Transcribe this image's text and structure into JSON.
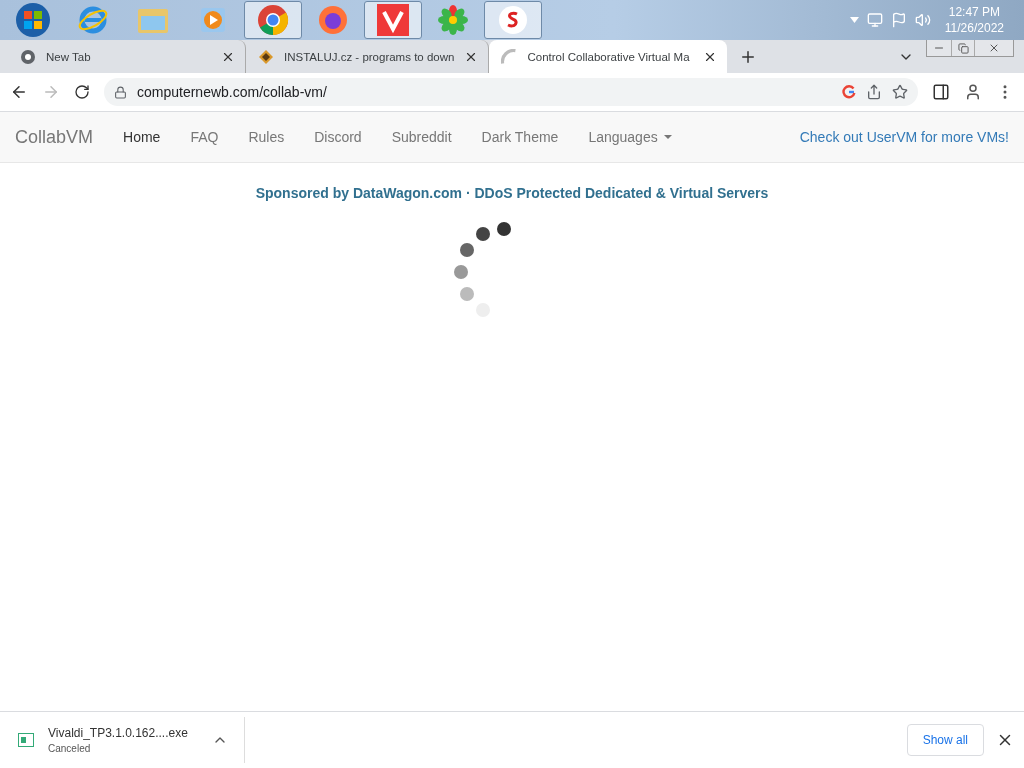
{
  "taskbar": {
    "apps": [
      {
        "kind": "start",
        "running": false
      },
      {
        "kind": "ie",
        "running": false
      },
      {
        "kind": "folder",
        "running": false
      },
      {
        "kind": "media",
        "running": false
      },
      {
        "kind": "chrome",
        "running": true
      },
      {
        "kind": "firefox",
        "running": false
      },
      {
        "kind": "vivaldi",
        "running": true
      },
      {
        "kind": "flower",
        "running": false
      },
      {
        "kind": "s",
        "running": true
      }
    ],
    "time": "12:47 PM",
    "date": "11/26/2022"
  },
  "tabs": [
    {
      "title": "New Tab",
      "kind": "chrome",
      "selected": false
    },
    {
      "title": "INSTALUJ.cz - programs to down",
      "kind": "diamond",
      "selected": false
    },
    {
      "title": "Control Collaborative Virtual Ma",
      "kind": "loading",
      "selected": true
    }
  ],
  "address": "computernewb.com/collab-vm/",
  "site": {
    "brand": "CollabVM",
    "nav": [
      {
        "label": "Home",
        "selected": true,
        "kind": "link"
      },
      {
        "label": "FAQ",
        "selected": false,
        "kind": "link"
      },
      {
        "label": "Rules",
        "selected": false,
        "kind": "link"
      },
      {
        "label": "Discord",
        "selected": false,
        "kind": "link"
      },
      {
        "label": "Subreddit",
        "selected": false,
        "kind": "link"
      },
      {
        "label": "Dark Theme",
        "selected": false,
        "kind": "link"
      },
      {
        "label": "Languages",
        "selected": false,
        "kind": "dropdown"
      }
    ],
    "promo": "Check out UserVM for more VMs!",
    "sponsor": "Sponsored by DataWagon.com · DDoS Protected Dedicated & Virtual Servers"
  },
  "download": {
    "file": "Vivaldi_TP3.1.0.162....exe",
    "status": "Canceled",
    "button": "Show all"
  }
}
